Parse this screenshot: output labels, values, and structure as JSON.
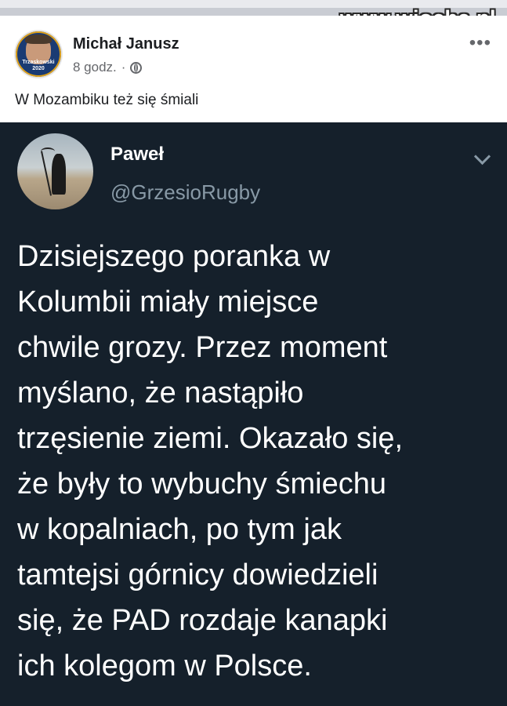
{
  "watermark": "www.wiocha.pl",
  "post": {
    "author": "Michał Janusz",
    "time": "8 godz.",
    "separator": "·",
    "more": "•••",
    "text": "W Mozambiku też się śmiali",
    "avatar_badge": "Trzaskowski 2020"
  },
  "tweet": {
    "name": "Paweł",
    "handle": "@GrzesioRugby",
    "text": "Dzisiejszego poranka w\nKolumbii miały miejsce\nchwile grozy. Przez moment\nmyślano, że nastąpiło\ntrzęsienie ziemi. Okazało się,\nże były to wybuchy śmiechu\nw kopalniach, po tym jak\ntamtejsi górnicy dowiedzieli\nsię, że PAD rozdaje kanapki\nich kolegom w Polsce."
  },
  "colors": {
    "tweet_bg": "#15202b",
    "tweet_text": "#ffffff",
    "tweet_muted": "#8899a6",
    "fb_text": "#1c1e21",
    "fb_muted": "#65676b"
  },
  "icons": [
    "globe-icon",
    "more-icon",
    "chevron-down-icon"
  ]
}
